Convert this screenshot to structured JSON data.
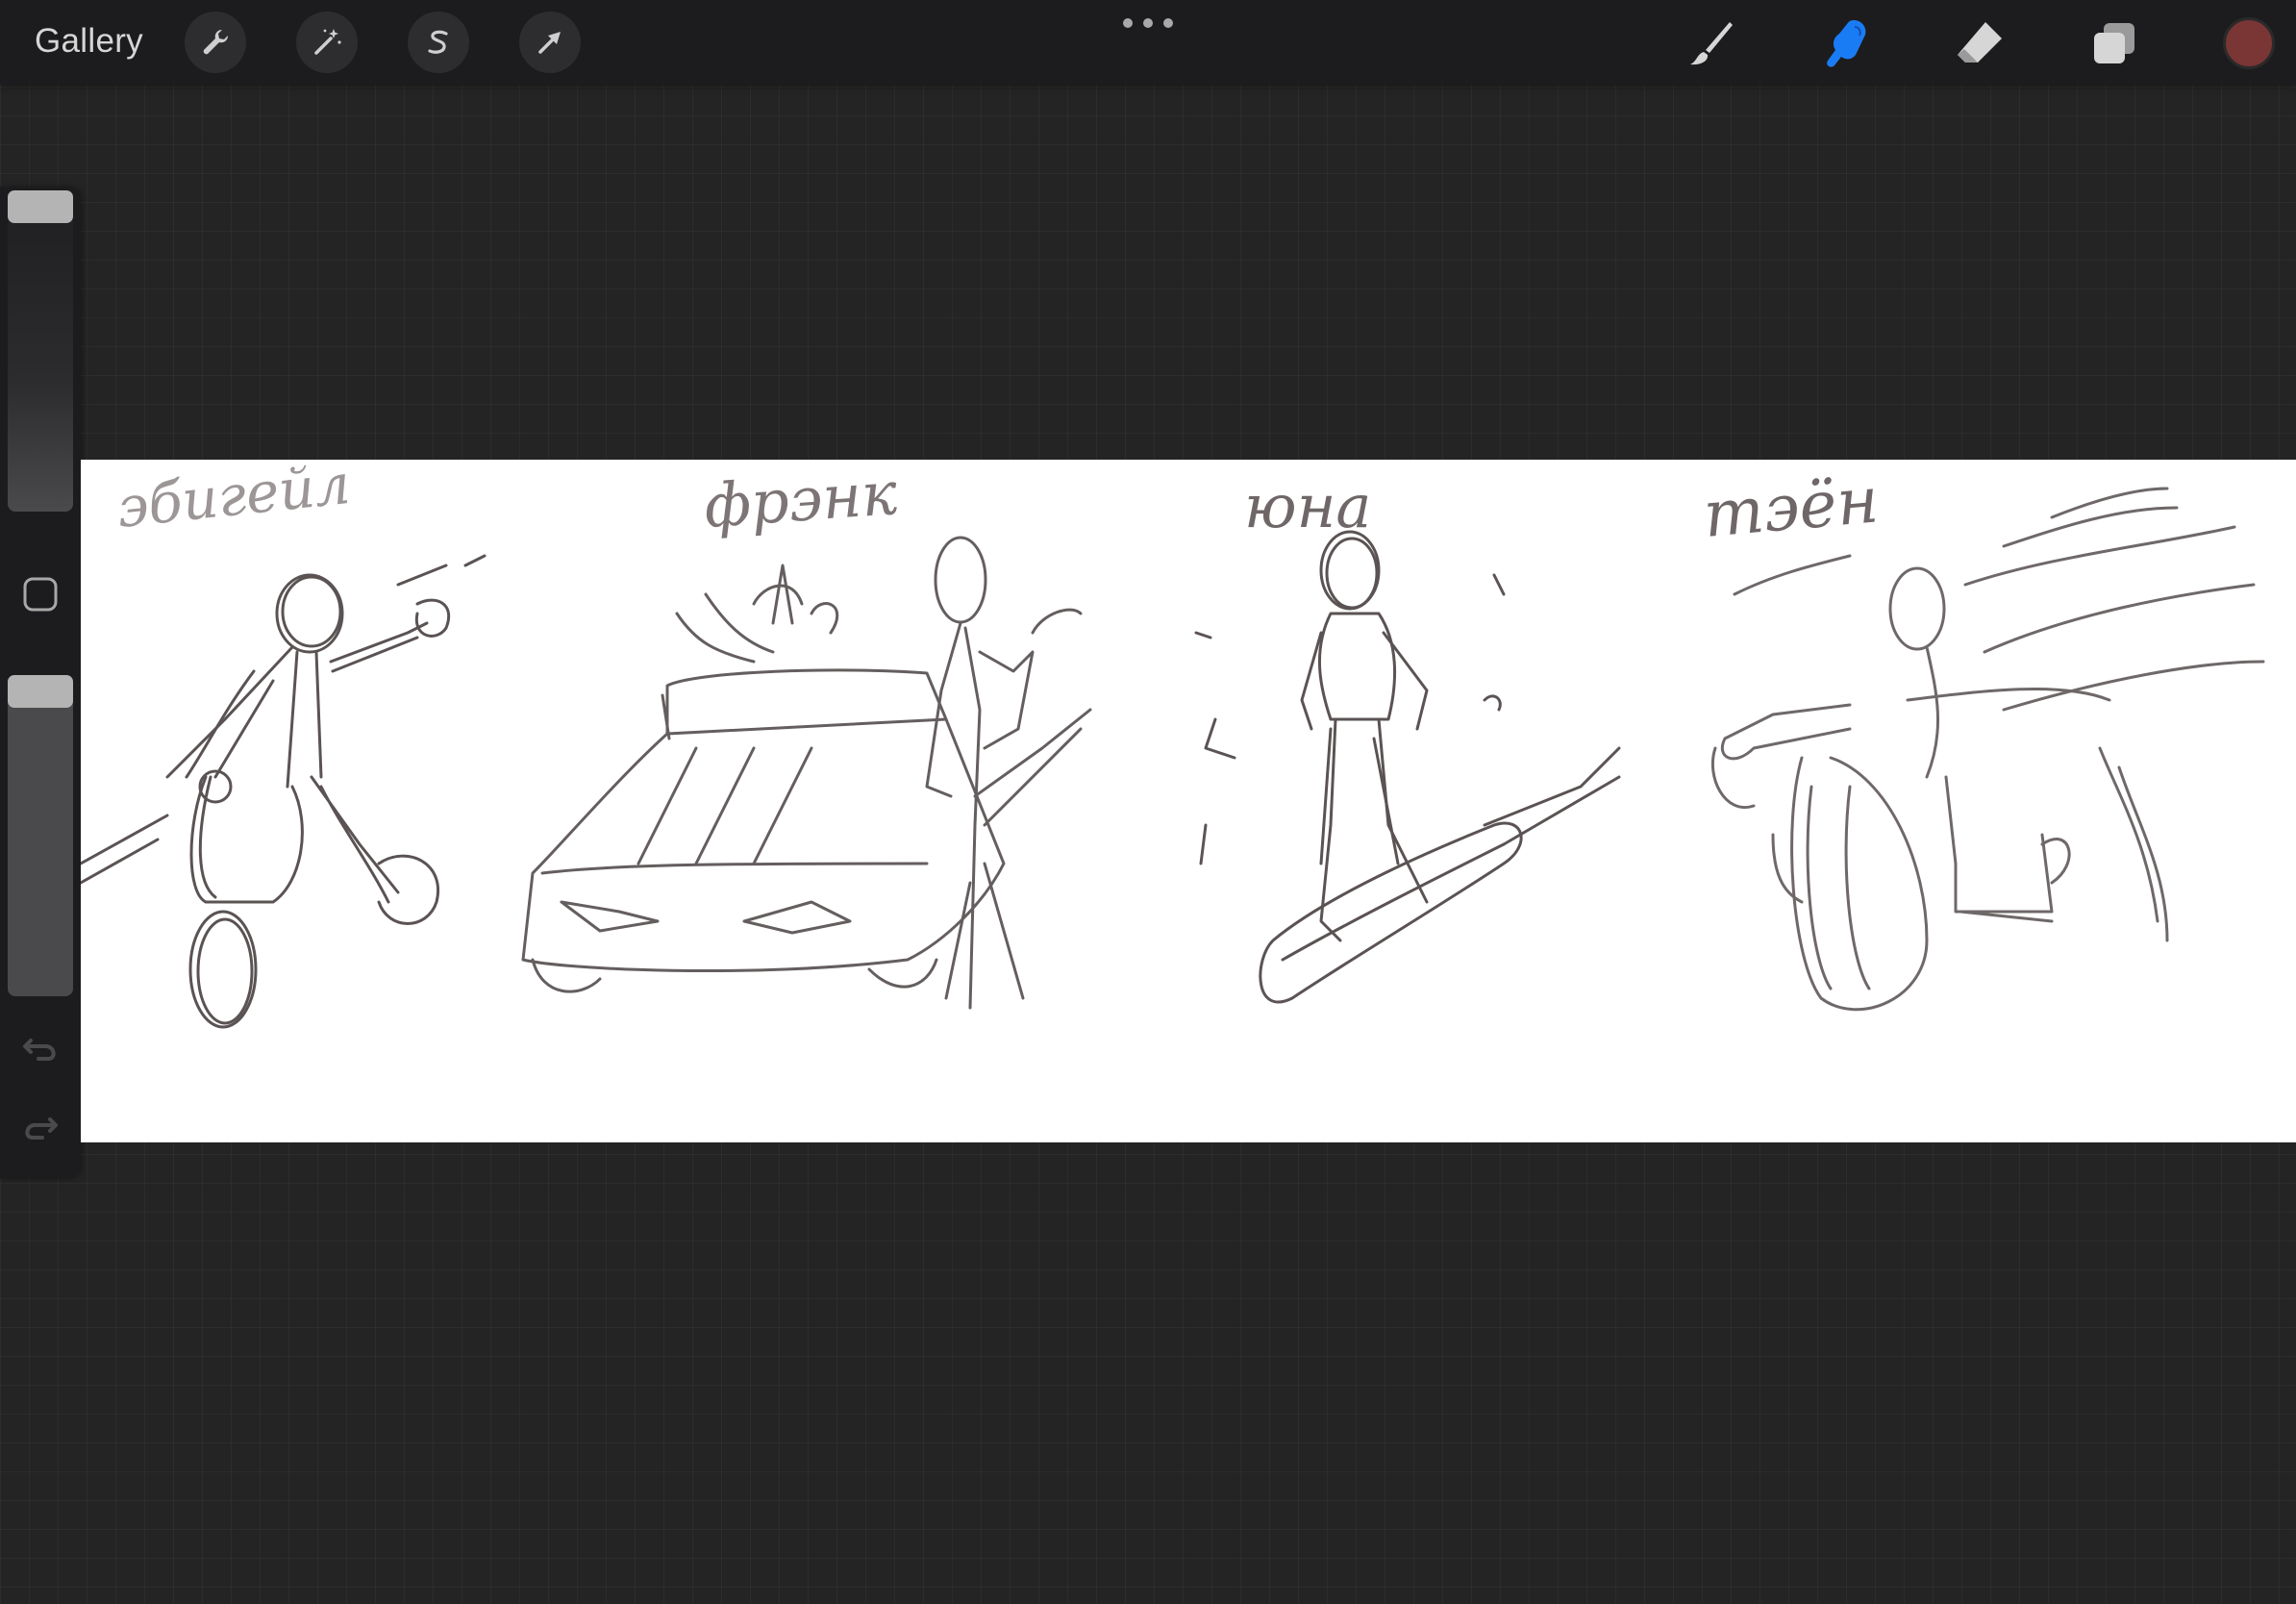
{
  "toolbar": {
    "gallery_label": "Gallery",
    "left_tools": [
      {
        "name": "actions",
        "icon": "wrench-icon"
      },
      {
        "name": "adjustments",
        "icon": "magic-wand-icon"
      },
      {
        "name": "selection",
        "icon": "selection-s-icon"
      },
      {
        "name": "transform",
        "icon": "arrow-cursor-icon"
      }
    ],
    "more_icon": "more-dots-icon",
    "right_tools": [
      {
        "name": "brush",
        "icon": "brush-icon",
        "active": false
      },
      {
        "name": "smudge",
        "icon": "smudge-finger-icon",
        "active": true
      },
      {
        "name": "eraser",
        "icon": "eraser-icon",
        "active": false
      },
      {
        "name": "layers",
        "icon": "layers-icon",
        "active": false
      }
    ],
    "current_color": "#7a3535",
    "active_tool_color": "#1a7cf5"
  },
  "sidebar": {
    "brush_size": 1.0,
    "brush_opacity": 1.0,
    "modify_icon": "square-modify-icon",
    "undo_icon": "undo-icon",
    "redo_icon": "redo-icon"
  },
  "canvas": {
    "background": "#ffffff",
    "sketch_color": "#3f3636",
    "labels": [
      "эбигейл",
      "фрэнк",
      "юна",
      "тэён"
    ]
  }
}
